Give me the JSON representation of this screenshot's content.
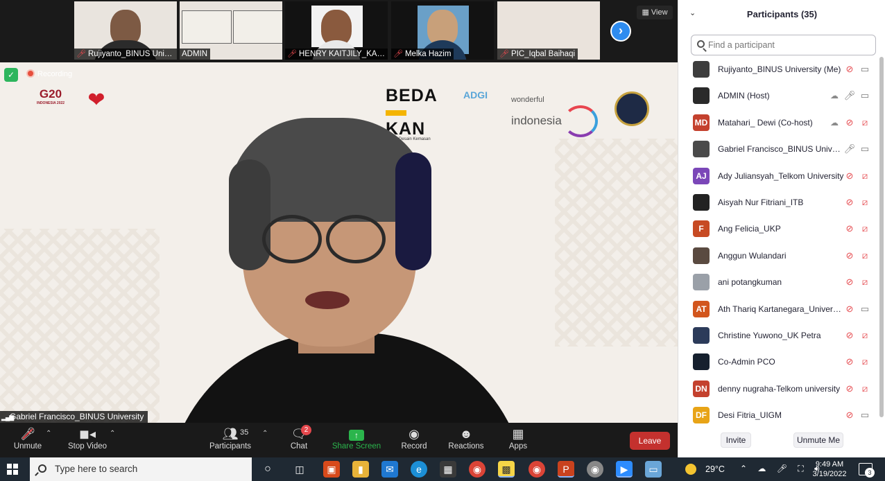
{
  "thumbnails": [
    {
      "name": "Rujiyanto_BINUS Univ...",
      "muted": true
    },
    {
      "name": "ADMIN",
      "muted": false
    },
    {
      "name": "HENRY KAITJILY_KADI...",
      "muted": true
    },
    {
      "name": "Melka Hazim",
      "muted": true
    },
    {
      "name": "PIC_Iqbal Baihaqi",
      "muted": true
    }
  ],
  "view_label": "View",
  "recording_label": "Recording",
  "logos": {
    "g20": "G20",
    "g20_sub": "INDONESIA 2022",
    "bedakan_1": "BEDA",
    "bedakan_2": "KAN",
    "bedakan_sub": "Bedah Desain Kemasan",
    "adgi": "ADGI",
    "wonderful": "wonderful",
    "indonesia": "indonesia"
  },
  "main_speaker_name": "Gabriel Francisco_BINUS University",
  "toolbar": {
    "unmute": "Unmute",
    "stop_video": "Stop Video",
    "participants": "Participants",
    "participants_count": "35",
    "chat": "Chat",
    "chat_badge": "2",
    "share_screen": "Share Screen",
    "record": "Record",
    "reactions": "Reactions",
    "apps": "Apps",
    "leave": "Leave"
  },
  "panel": {
    "title": "Participants (35)",
    "search_placeholder": "Find a participant",
    "invite": "Invite",
    "unmute_me": "Unmute Me"
  },
  "participants": [
    {
      "name": "Rujiyanto_BINUS University (Me)",
      "avatar": "",
      "color": "#3d3d3d",
      "cloud": false,
      "mic": "off",
      "cam": "on"
    },
    {
      "name": "ADMIN (Host)",
      "avatar": "",
      "color": "#2a2a2a",
      "cloud": true,
      "mic": "on",
      "cam": "on"
    },
    {
      "name": "Matahari_ Dewi (Co-host)",
      "avatar": "MD",
      "color": "#c4412e",
      "cloud": true,
      "mic": "off",
      "cam": "off"
    },
    {
      "name": "Gabriel Francisco_BINUS University",
      "avatar": "",
      "color": "#4a4a4a",
      "cloud": false,
      "mic": "on",
      "cam": "on"
    },
    {
      "name": "Ady Juliansyah_Telkom University",
      "avatar": "AJ",
      "color": "#7b47b8",
      "cloud": false,
      "mic": "off",
      "cam": "off"
    },
    {
      "name": "Aisyah Nur Fitriani_ITB",
      "avatar": "",
      "color": "#222222",
      "cloud": false,
      "mic": "off",
      "cam": "off"
    },
    {
      "name": "Ang Felicia_UKP",
      "avatar": "F",
      "color": "#c74a23",
      "cloud": false,
      "mic": "off",
      "cam": "off"
    },
    {
      "name": "Anggun Wulandari",
      "avatar": "",
      "color": "#5a4a40",
      "cloud": false,
      "mic": "off",
      "cam": "off"
    },
    {
      "name": "ani potangkuman",
      "avatar": "",
      "color": "#9aa0a8",
      "cloud": false,
      "mic": "off",
      "cam": "off"
    },
    {
      "name": "Ath Thariq Kartanegara_University",
      "avatar": "AT",
      "color": "#d2561d",
      "cloud": false,
      "mic": "off",
      "cam": "on"
    },
    {
      "name": "Christine Yuwono_UK Petra",
      "avatar": "",
      "color": "#2c3b5a",
      "cloud": false,
      "mic": "off",
      "cam": "off"
    },
    {
      "name": "Co-Admin PCO",
      "avatar": "",
      "color": "#16202e",
      "cloud": false,
      "mic": "off",
      "cam": "off"
    },
    {
      "name": "denny nugraha-Telkom university",
      "avatar": "DN",
      "color": "#c4412e",
      "cloud": false,
      "mic": "off",
      "cam": "off"
    },
    {
      "name": "Desi Fitria_UIGM",
      "avatar": "DF",
      "color": "#e8a417",
      "cloud": false,
      "mic": "off",
      "cam": "on"
    }
  ],
  "taskbar": {
    "search_placeholder": "Type here to search",
    "temperature": "29°C",
    "time": "9:49 AM",
    "date": "3/19/2022",
    "notification_count": "3"
  }
}
